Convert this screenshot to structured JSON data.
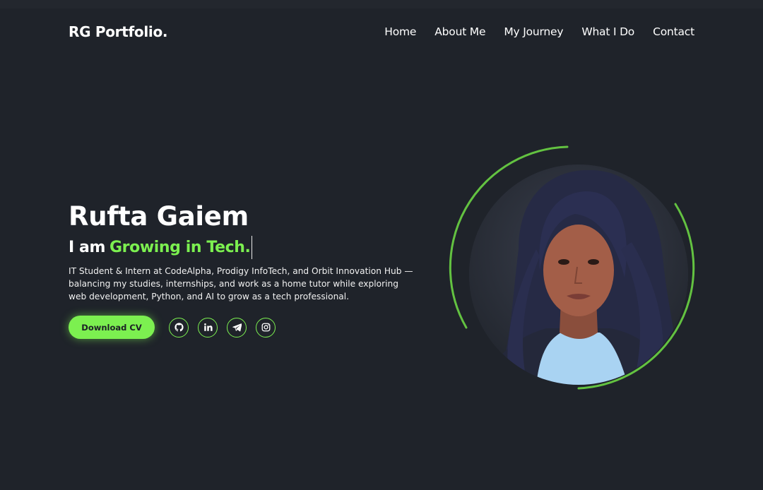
{
  "nav": {
    "logo": "RG Portfolio.",
    "links": [
      "Home",
      "About Me",
      "My Journey",
      "What I Do",
      "Contact"
    ]
  },
  "hero": {
    "name": "Rufta Gaiem",
    "tag_prefix": "I am",
    "tag_accent": "Growing in Tech.",
    "description": "IT Student & Intern at CodeAlpha, Prodigy InfoTech, and Orbit Innovation Hub — balancing my studies, internships, and work as a home tutor while exploring web development, Python, and AI to grow as a tech professional.",
    "cv_button": "Download CV",
    "socials": [
      "github-icon",
      "linkedin-icon",
      "telegram-icon",
      "instagram-icon"
    ]
  },
  "colors": {
    "background": "#1f232a",
    "accent": "#7cf050",
    "text": "#ffffff"
  }
}
